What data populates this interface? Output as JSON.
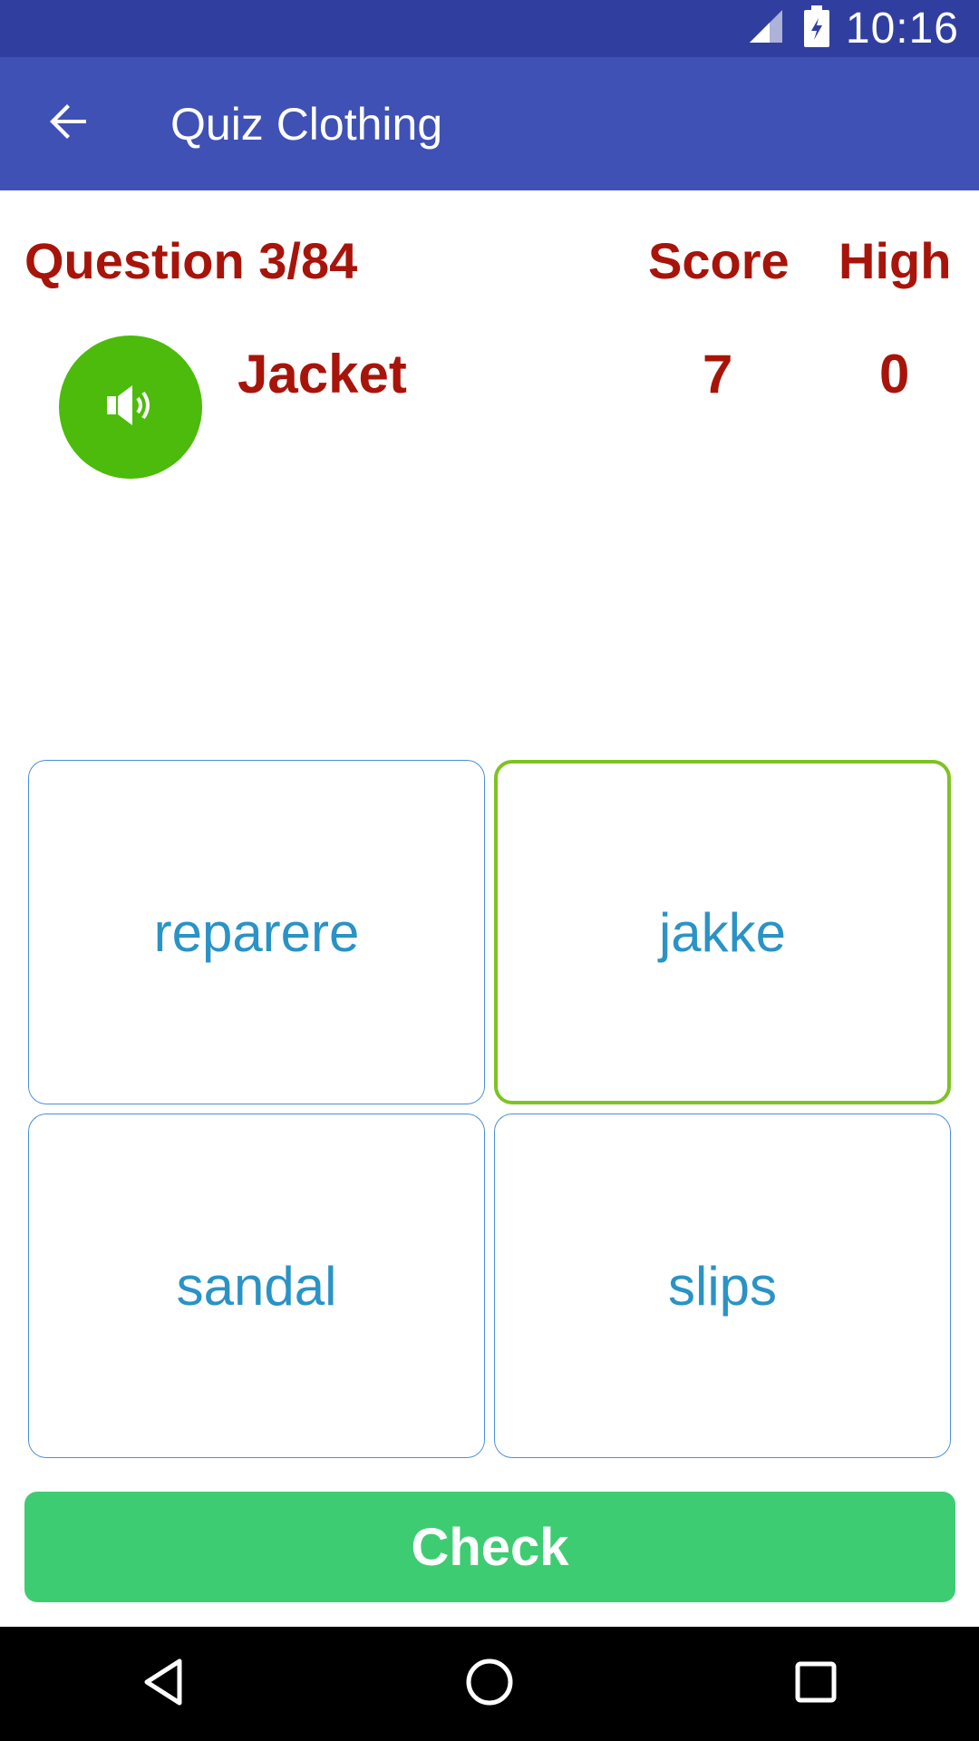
{
  "status_bar": {
    "time": "10:16",
    "icons": [
      "signal-icon",
      "battery-icon"
    ]
  },
  "app_bar": {
    "back_icon": "arrow-back-icon",
    "title": "Quiz Clothing"
  },
  "quiz": {
    "question_label": "Question 3/84",
    "score_label": "Score",
    "high_label": "High",
    "word": "Jacket",
    "score_value": "7",
    "high_value": "0",
    "speaker_icon": "speaker-icon"
  },
  "options": [
    {
      "label": "reparere",
      "selected": false
    },
    {
      "label": "jakke",
      "selected": true
    },
    {
      "label": "sandal",
      "selected": false
    },
    {
      "label": "slips",
      "selected": false
    }
  ],
  "check_button": {
    "label": "Check"
  },
  "nav_bar": {
    "icons": [
      "back-triangle-icon",
      "home-circle-icon",
      "recents-square-icon"
    ]
  },
  "colors": {
    "status_bar": "#303f9f",
    "app_bar": "#3f51b5",
    "accent_text": "#a8140a",
    "speaker_bg": "#4cbb0b",
    "option_text": "#2a93c6",
    "option_border": "#4a90d9",
    "selected_border": "#7ec322",
    "check_button": "#3ecc73"
  }
}
